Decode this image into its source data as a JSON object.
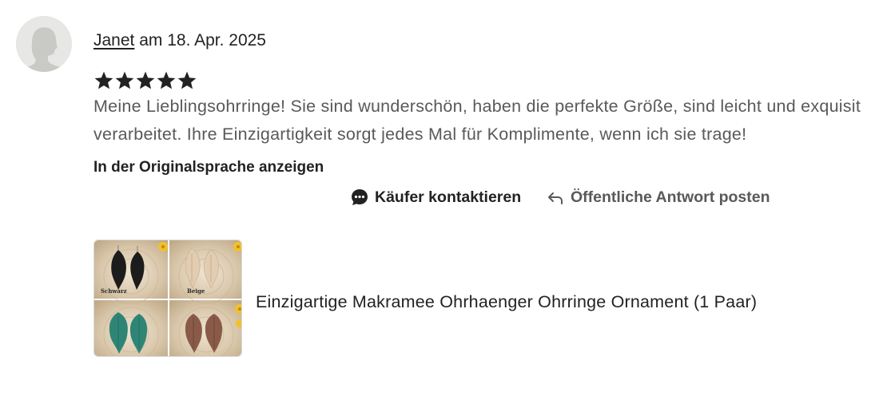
{
  "review": {
    "reviewer_name": "Janet",
    "date_text": " am 18. Apr. 2025",
    "rating": 5,
    "rating_max": 5,
    "text": "Meine Lieblingsohrringe! Sie sind wunderschön, haben die perfekte Größe, sind leicht und exquisit verarbeitet. Ihre Einzigartigkeit sorgt jedes Mal für Komplimente, wenn ich sie trage!",
    "translate_label": "In der Originalsprache anzeigen"
  },
  "actions": {
    "contact_label": "Käufer kontaktieren",
    "contact_icon": "chat-bubble-icon",
    "reply_label": "Öffentliche Antwort posten",
    "reply_icon": "reply-arrow-icon"
  },
  "product": {
    "title": "Einzigartige Makramee Ohrhaenger Ohrringe Ornament (1 Paar)",
    "thumbnail_labels": [
      "Schwarz",
      "Beige"
    ]
  },
  "colors": {
    "text_primary": "#222222",
    "text_secondary": "#595959",
    "star": "#222222",
    "avatar_bg": "#e7e7e5",
    "earring_black": "#1c1c1c",
    "earring_beige": "#e2cdb3",
    "earring_green": "#2e8576",
    "earring_brown": "#8a5a49"
  }
}
